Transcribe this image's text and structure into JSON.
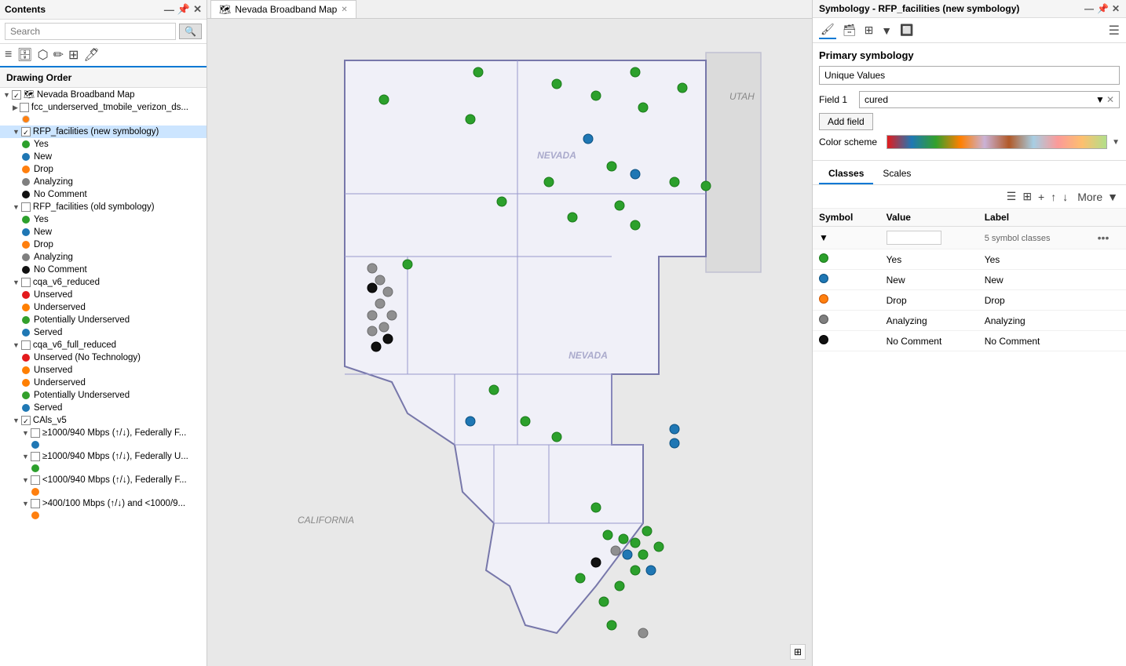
{
  "contents_panel": {
    "title": "Contents",
    "search_placeholder": "Search",
    "drawing_order_label": "Drawing Order",
    "layers": [
      {
        "name": "Nevada Broadband Map",
        "type": "group",
        "expanded": true,
        "checked": true
      },
      {
        "name": "fcc_underserved_tmobile_verizon_ds...",
        "type": "layer",
        "indent": 1,
        "checked": false
      },
      {
        "name": "RFP_facilities (new symbology)",
        "type": "layer",
        "indent": 1,
        "checked": true,
        "selected": true,
        "sublayers": [
          {
            "name": "Yes",
            "color": "#2ca02c"
          },
          {
            "name": "New",
            "color": "#1f77b4"
          },
          {
            "name": "Drop",
            "color": "#ff7f0e"
          },
          {
            "name": "Analyzing",
            "color": "#7f7f7f"
          },
          {
            "name": "No Comment",
            "color": "#000000"
          }
        ]
      },
      {
        "name": "RFP_facilities (old symbology)",
        "type": "layer",
        "indent": 1,
        "checked": false,
        "sublayers": [
          {
            "name": "Yes",
            "color": "#2ca02c"
          },
          {
            "name": "New",
            "color": "#1f77b4"
          },
          {
            "name": "Drop",
            "color": "#ff7f0e"
          },
          {
            "name": "Analyzing",
            "color": "#7f7f7f"
          },
          {
            "name": "No Comment",
            "color": "#000000"
          }
        ]
      },
      {
        "name": "cqa_v6_reduced",
        "type": "layer",
        "indent": 1,
        "checked": false,
        "sublayers": [
          {
            "name": "Unserved",
            "color": "#e31a1c"
          },
          {
            "name": "Underserved",
            "color": "#ff7f00"
          },
          {
            "name": "Potentially Underserved",
            "color": "#33a02c"
          },
          {
            "name": "Served",
            "color": "#1f78b4"
          }
        ]
      },
      {
        "name": "cqa_v6_full_reduced",
        "type": "layer",
        "indent": 1,
        "checked": false,
        "sublayers": [
          {
            "name": "Unserved (No Technology)",
            "color": "#e31a1c"
          },
          {
            "name": "Unserved",
            "color": "#ff7f00"
          },
          {
            "name": "Underserved",
            "color": "#ff7f00"
          },
          {
            "name": "Potentially Underserved",
            "color": "#33a02c"
          },
          {
            "name": "Served",
            "color": "#1f78b4"
          }
        ]
      },
      {
        "name": "CAls_v5",
        "type": "layer",
        "indent": 1,
        "checked": true,
        "sublayers": [
          {
            "name": "≥1000/940 Mbps (↑/↓), Federally F...",
            "color": "#1f77b4",
            "indent": 2
          },
          {
            "name": "≥1000/940 Mbps (↑/↓), Federally U...",
            "color": "#2ca02c",
            "indent": 2
          },
          {
            "name": "<1000/940 Mbps (↑/↓), Federally F...",
            "color": "#ff7f0e",
            "indent": 2
          },
          {
            "name": ">400/100 Mbps (↑/↓) and <1000/9...",
            "color": "#ff7f0e",
            "indent": 2
          }
        ]
      }
    ]
  },
  "map": {
    "tab_label": "Nevada Broadband Map",
    "label_nevada": "NEVADA",
    "label_california": "CALIFORNIA",
    "label_utah": "UTAH"
  },
  "symbology": {
    "title": "Symbology - RFP_facilities (new symbology)",
    "primary_symbology_label": "Primary symbology",
    "primary_symbology_value": "Unique Values",
    "field1_label": "Field 1",
    "field1_value": "cured",
    "add_field_label": "Add field",
    "color_scheme_label": "Color scheme",
    "tabs": [
      "Classes",
      "Scales"
    ],
    "active_tab": "Classes",
    "more_label": "More",
    "table_headers": [
      "Symbol",
      "Value",
      "Label"
    ],
    "all_other_values_count": "5 symbol classes",
    "classes": [
      {
        "value": "Yes",
        "label": "Yes",
        "color": "#2ca02c"
      },
      {
        "value": "New",
        "label": "New",
        "color": "#1f77b4"
      },
      {
        "value": "Drop",
        "label": "Drop",
        "color": "#ff7f0e"
      },
      {
        "value": "Analyzing",
        "label": "Analyzing",
        "color": "#7f7f7f"
      },
      {
        "value": "No Comment",
        "label": "No Comment",
        "color": "#111111"
      }
    ],
    "toolbar_icons": [
      "list-icon",
      "grid-icon",
      "add-icon",
      "up-icon",
      "down-icon"
    ]
  }
}
